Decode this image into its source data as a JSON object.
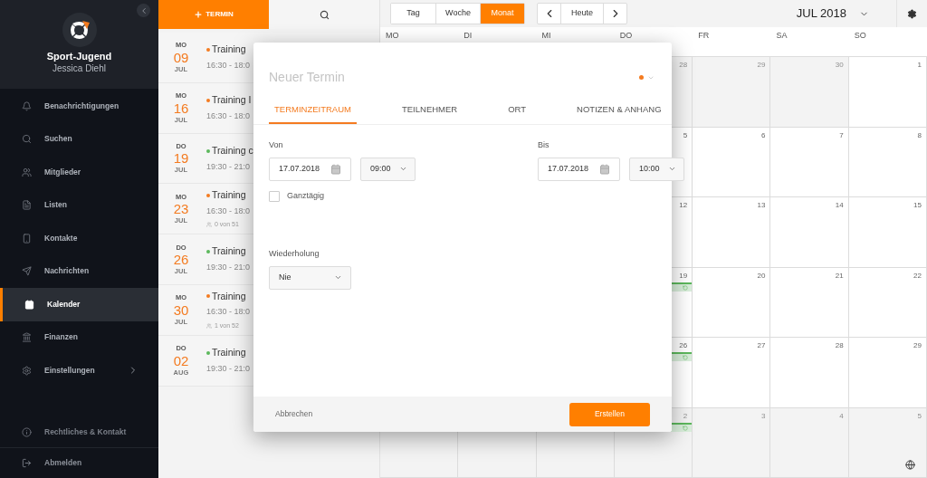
{
  "sidebar": {
    "club": "Sport-Jugend",
    "user": "Jessica Diehl",
    "items": [
      {
        "label": "Benachrichtigungen",
        "selected": false
      },
      {
        "label": "Suchen",
        "selected": false
      },
      {
        "label": "Mitglieder",
        "selected": false
      },
      {
        "label": "Listen",
        "selected": false
      },
      {
        "label": "Kontakte",
        "selected": false
      },
      {
        "label": "Nachrichten",
        "selected": false
      },
      {
        "label": "Kalender",
        "selected": true
      },
      {
        "label": "Finanzen",
        "selected": false
      },
      {
        "label": "Einstellungen",
        "selected": false,
        "submenu": true
      }
    ],
    "footer_items": [
      {
        "label": "Rechtliches & Kontakt",
        "kind": "muted"
      },
      {
        "label": "Abmelden",
        "kind": "action"
      }
    ]
  },
  "event_list": {
    "new_button": "TERMIN",
    "events": [
      {
        "weekday": "MO",
        "day": "09",
        "month": "JUL",
        "title": "Training",
        "time": "16:30 - 18:0",
        "color": "#f47b20"
      },
      {
        "weekday": "MO",
        "day": "16",
        "month": "JUL",
        "title": "Training I",
        "time": "16:30 - 18:0",
        "color": "#f47b20"
      },
      {
        "weekday": "DO",
        "day": "19",
        "month": "JUL",
        "title": "Training c",
        "time": "19:30 - 21:0",
        "color": "#5cb85c"
      },
      {
        "weekday": "MO",
        "day": "23",
        "month": "JUL",
        "title": "Training",
        "time": "16:30 - 18:0",
        "participants": "0 von 51",
        "color": "#f47b20"
      },
      {
        "weekday": "DO",
        "day": "26",
        "month": "JUL",
        "title": "Training",
        "time": "19:30 - 21:0",
        "color": "#5cb85c"
      },
      {
        "weekday": "MO",
        "day": "30",
        "month": "JUL",
        "title": "Training",
        "time": "16:30 - 18:0",
        "participants": "1 von 52",
        "color": "#f47b20"
      },
      {
        "weekday": "DO",
        "day": "02",
        "month": "AUG",
        "title": "Training",
        "time": "19:30 - 21:0",
        "color": "#5cb85c"
      }
    ]
  },
  "calendar": {
    "views": [
      {
        "label": "Tag",
        "selected": false
      },
      {
        "label": "Woche",
        "selected": false
      },
      {
        "label": "Monat",
        "selected": true
      }
    ],
    "today_button": "Heute",
    "month_label": "JUL 2018",
    "weekdays": [
      "MO",
      "DI",
      "MI",
      "DO",
      "FR",
      "SA",
      "SO"
    ],
    "weeks": [
      [
        {
          "day": "28",
          "outside": true
        },
        {
          "day": "29",
          "outside": true
        },
        {
          "day": "30",
          "outside": true
        },
        {
          "day": "1",
          "outside": false
        }
      ],
      [
        {
          "day": "5",
          "outside": false
        },
        {
          "day": "6",
          "outside": false
        },
        {
          "day": "7",
          "outside": false
        },
        {
          "day": "8",
          "outside": false
        }
      ],
      [
        {
          "day": "12",
          "outside": false
        },
        {
          "day": "13",
          "outside": false
        },
        {
          "day": "14",
          "outside": false
        },
        {
          "day": "15",
          "outside": false
        }
      ],
      [
        {
          "day": "19",
          "outside": false,
          "events": [
            {
              "color": "#5cb85c"
            }
          ]
        },
        {
          "day": "20",
          "outside": false
        },
        {
          "day": "21",
          "outside": false
        },
        {
          "day": "22",
          "outside": false
        }
      ],
      [
        {
          "day": "26",
          "outside": false,
          "events": [
            {
              "color": "#5cb85c"
            }
          ]
        },
        {
          "day": "27",
          "outside": false
        },
        {
          "day": "28",
          "outside": false
        },
        {
          "day": "29",
          "outside": false
        }
      ],
      [
        {
          "outside": true
        },
        {
          "outside": true
        },
        {
          "outside": true
        },
        {
          "day": "2",
          "outside": true,
          "events": [
            {
              "color": "#5cb85c"
            }
          ]
        },
        {
          "day": "3",
          "outside": true
        },
        {
          "day": "4",
          "outside": true
        },
        {
          "day": "5",
          "outside": true
        }
      ]
    ]
  },
  "dialog": {
    "title": "Neuer Termin",
    "color": "#f47b20",
    "tabs": [
      {
        "label": "TERMINZEITRAUM",
        "selected": true
      },
      {
        "label": "TEILNEHMER",
        "selected": false
      },
      {
        "label": "ORT",
        "selected": false
      },
      {
        "label": "NOTIZEN & ANHANG",
        "selected": false
      }
    ],
    "from": {
      "label": "Von",
      "date": "17.07.2018",
      "time": "09:00"
    },
    "to": {
      "label": "Bis",
      "date": "17.07.2018",
      "time": "10:00"
    },
    "all_day": {
      "label": "Ganztägig",
      "checked": false
    },
    "repeat": {
      "label": "Wiederholung",
      "value": "Nie"
    },
    "cancel": "Abbrechen",
    "submit": "Erstellen"
  }
}
